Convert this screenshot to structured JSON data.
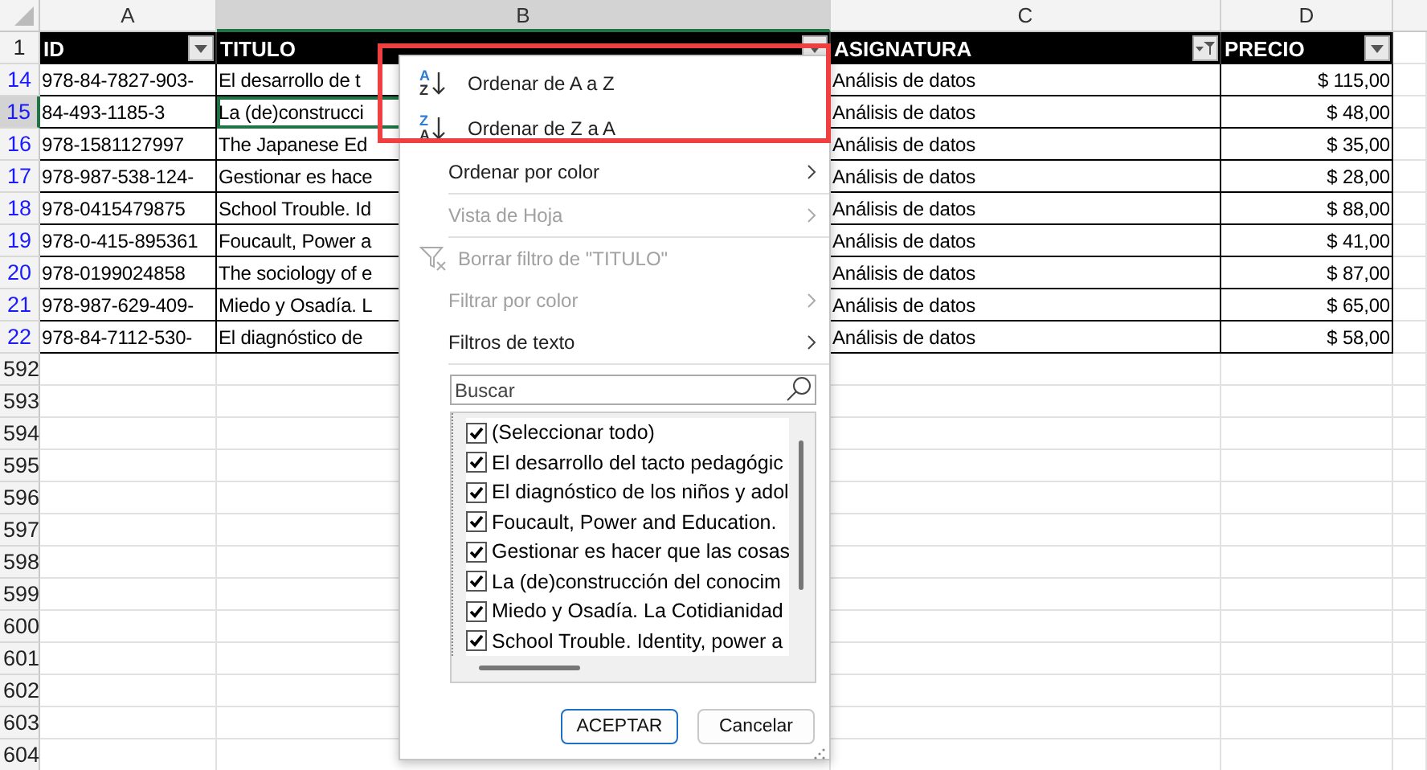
{
  "columns": [
    {
      "letter": "A",
      "selected": false
    },
    {
      "letter": "B",
      "selected": true
    },
    {
      "letter": "C",
      "selected": false
    },
    {
      "letter": "D",
      "selected": false
    }
  ],
  "header_row": {
    "number": "1",
    "cells": [
      {
        "text": "ID",
        "filtered": false
      },
      {
        "text": "TITULO",
        "filtered": false
      },
      {
        "text": "ASIGNATURA",
        "filtered": true
      },
      {
        "text": "PRECIO",
        "filtered": false
      }
    ]
  },
  "rows": [
    {
      "number": "14",
      "filtered": true,
      "selected": false,
      "cells": [
        "978-84-7827-903-",
        "El desarrollo de t",
        "Análisis de datos",
        "$ 115,00"
      ]
    },
    {
      "number": "15",
      "filtered": true,
      "selected": true,
      "cells": [
        "84-493-1185-3",
        "La (de)construcci",
        "Análisis de datos",
        "$ 48,00"
      ]
    },
    {
      "number": "16",
      "filtered": true,
      "selected": false,
      "cells": [
        "978-1581127997",
        "The Japanese Ed",
        "Análisis de datos",
        "$ 35,00"
      ]
    },
    {
      "number": "17",
      "filtered": true,
      "selected": false,
      "cells": [
        "978-987-538-124-",
        "Gestionar es hace",
        "Análisis de datos",
        "$ 28,00"
      ]
    },
    {
      "number": "18",
      "filtered": true,
      "selected": false,
      "cells": [
        "978-0415479875",
        "School Trouble. Id",
        "Análisis de datos",
        "$ 88,00"
      ]
    },
    {
      "number": "19",
      "filtered": true,
      "selected": false,
      "cells": [
        "978-0-415-895361",
        "Foucault, Power a",
        "Análisis de datos",
        "$ 41,00"
      ]
    },
    {
      "number": "20",
      "filtered": true,
      "selected": false,
      "cells": [
        "978-0199024858",
        "The sociology of e",
        "Análisis de datos",
        "$ 87,00"
      ]
    },
    {
      "number": "21",
      "filtered": true,
      "selected": false,
      "cells": [
        "978-987-629-409-",
        "Miedo y Osadía. L",
        "Análisis de datos",
        "$ 65,00"
      ]
    },
    {
      "number": "22",
      "filtered": true,
      "selected": false,
      "cells": [
        "978-84-7112-530-",
        "El diagnóstico de",
        "Análisis de datos",
        "$ 58,00"
      ]
    },
    {
      "number": "592",
      "filtered": false,
      "selected": false,
      "cells": []
    },
    {
      "number": "593",
      "filtered": false,
      "selected": false,
      "cells": []
    },
    {
      "number": "594",
      "filtered": false,
      "selected": false,
      "cells": []
    },
    {
      "number": "595",
      "filtered": false,
      "selected": false,
      "cells": []
    },
    {
      "number": "596",
      "filtered": false,
      "selected": false,
      "cells": []
    },
    {
      "number": "597",
      "filtered": false,
      "selected": false,
      "cells": []
    },
    {
      "number": "598",
      "filtered": false,
      "selected": false,
      "cells": []
    },
    {
      "number": "599",
      "filtered": false,
      "selected": false,
      "cells": []
    },
    {
      "number": "600",
      "filtered": false,
      "selected": false,
      "cells": []
    },
    {
      "number": "601",
      "filtered": false,
      "selected": false,
      "cells": []
    },
    {
      "number": "602",
      "filtered": false,
      "selected": false,
      "cells": []
    },
    {
      "number": "603",
      "filtered": false,
      "selected": false,
      "cells": []
    },
    {
      "number": "604",
      "filtered": false,
      "selected": false,
      "cells": []
    }
  ],
  "filter_menu": {
    "items": [
      {
        "kind": "sort",
        "label": "Ordenar de A a Z",
        "icon_letters": [
          "A",
          "Z"
        ],
        "disabled": false
      },
      {
        "kind": "sort",
        "label": "Ordenar de Z a A",
        "icon_letters": [
          "Z",
          "A"
        ],
        "disabled": false
      },
      {
        "kind": "submenu",
        "label": "Ordenar por color",
        "disabled": false
      },
      {
        "kind": "submenu",
        "label": "Vista de Hoja",
        "disabled": true
      },
      {
        "kind": "clear",
        "label": "Borrar filtro de \"TITULO\"",
        "disabled": true
      },
      {
        "kind": "submenu",
        "label": "Filtrar por color",
        "disabled": true
      },
      {
        "kind": "submenu",
        "label": "Filtros de texto",
        "disabled": false
      }
    ],
    "search": {
      "placeholder": "Buscar"
    },
    "values": [
      {
        "label": "(Seleccionar todo)",
        "checked": true
      },
      {
        "label": "El desarrollo del tacto pedagógic",
        "checked": true
      },
      {
        "label": "El diagnóstico de los niños y adol",
        "checked": true
      },
      {
        "label": "Foucault, Power and Education.",
        "checked": true
      },
      {
        "label": "Gestionar es hacer que las cosas",
        "checked": true
      },
      {
        "label": "La (de)construcción del conocim",
        "checked": true
      },
      {
        "label": "Miedo y Osadía. La Cotidianidad",
        "checked": true
      },
      {
        "label": "School Trouble. Identity, power a",
        "checked": true
      }
    ],
    "buttons": [
      {
        "label": "ACEPTAR",
        "primary": true
      },
      {
        "label": "Cancelar",
        "primary": false
      }
    ]
  }
}
